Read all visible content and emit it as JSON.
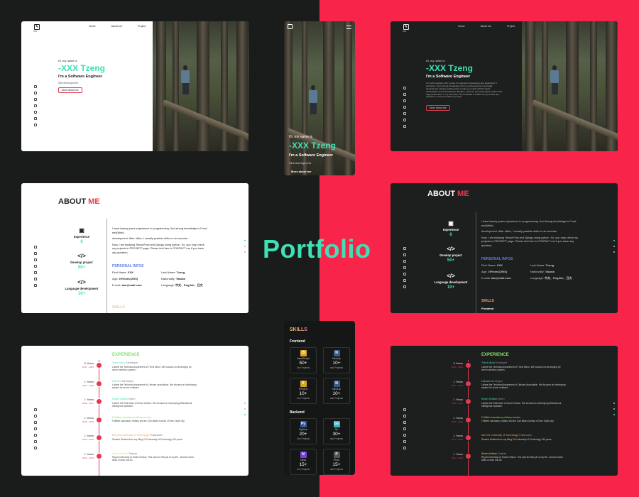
{
  "title": "Portfolio",
  "colors": {
    "left_bg": "#1a1b1b",
    "right_bg": "#f8244a",
    "accent_teal": "#3ee0b4",
    "accent_red": "#e8384f"
  },
  "nav": {
    "home": "Home",
    "about": "About me",
    "project": "Project"
  },
  "logo": {
    "glyph": "✎",
    "caption": "XXX"
  },
  "hero": {
    "greeting": "Hi, my name is",
    "name": "-XXX Tzeng",
    "role": "I'm a Software Engineer",
    "sub": "Self-development",
    "bio": "I'm much engineer with 3 years of experience developing web application in enterprise. Have strong knowledge of front-end development and agile development. Always seeking ways to stay up-to-date with the latest technologies and best practices. Besides, however, personal projects which have high performance in my own team. Don't hesitate to reach out if you have any questions or concerns about my work.",
    "button": "More about me"
  },
  "about": {
    "title_a": "ABOUT",
    "title_b": "ME",
    "stats": [
      {
        "icon": "briefcase-icon",
        "label": "Experience",
        "value": "6"
      },
      {
        "icon": "code-icon",
        "label": "Develop project",
        "value": "50+"
      },
      {
        "icon": "code-icon",
        "label": "Language development",
        "value": "10+"
      }
    ],
    "p1": "I have twenty years experience in programming. And strong knowledge in Front-end(Web).",
    "p2": "development. After office, I usually practise drills or do exercise.",
    "p3": "Now, I am studying TensorFlow and Django using python. So, you may check my projects in PROJECT page. Please feel free to CONTACT me if you have any question.",
    "personal_title": "PERSONAL INFOS",
    "info": {
      "first_name_label": "First Name:",
      "first_name": "XXX",
      "last_name_label": "Last Name:",
      "last_name": "Tzeng",
      "age_label": "Age:",
      "age": "29Years(1993)",
      "nationality_label": "Nationality:",
      "nationality": "Taiwan",
      "email_label": "E-mail:",
      "email": "ako@mail.com",
      "language_label": "Language:",
      "language": "中文、English、日文"
    },
    "skills_title": "SKILLS",
    "skills_sub": "Frontend"
  },
  "skills": {
    "title": "SKILLS",
    "frontend_label": "Frontend",
    "backend_label": "Backend",
    "frontend": [
      {
        "icon": "JS",
        "name": "JavaScript",
        "count": "50+",
        "label": "Live Projects",
        "color": "#e2a420"
      },
      {
        "icon": "N",
        "name": "Next.js",
        "count": "10+",
        "label": "asic Projects",
        "color": "#3b5d89"
      },
      {
        "icon": "5",
        "name": "HTML5",
        "count": "10+",
        "label": "Live Projects",
        "color": "#d9a424"
      },
      {
        "icon": "N",
        "name": "Next.js",
        "count": "10+",
        "label": "asic Projects",
        "color": "#3b5d89"
      }
    ],
    "backend": [
      {
        "icon": "Py",
        "name": "Python",
        "count": "20+",
        "label": "Live Projects",
        "color": "#2f5b9c"
      },
      {
        "icon": "Go",
        "name": "Go",
        "count": "30+",
        "label": "asic Projects",
        "color": "#3bb3c9"
      },
      {
        "icon": "N",
        "name": "Nest",
        "count": "15+",
        "label": "Live Projects",
        "color": "#7a3ee8"
      },
      {
        "icon": "P",
        "name": "Pixel",
        "count": "15+",
        "label": "asic Projects",
        "color": "#555"
      }
    ]
  },
  "experience": {
    "title": "EXPERIENCE",
    "items": [
      {
        "years": "6 Years",
        "range": "2017 - 2023",
        "title": "Trend Micro",
        "role": "Developer",
        "desc": "Lisbeel the Technical department of Trend Micro. We focused on developing for server antivirus system.",
        "color": "#3ee0b4"
      },
      {
        "years": "1 Years",
        "range": "2017 - 2018",
        "title": "Lifecare",
        "role": "Developer",
        "desc": "Lisbeel the Technical department of Lifecare Association. We focused on developing system for server software.",
        "color": "#3ee0b4"
      },
      {
        "years": "1 Years",
        "range": "2016 - 2017",
        "title": "Smart eVision",
        "role": "Intern",
        "desc": "Lisbeel the R&D team of Smart eVision. We focused on developing MiNotebook intelligence software.",
        "color": "#3ee0b4"
      },
      {
        "years": "1 Years",
        "range": "2015 - 2016",
        "title": "Fulfilled mandatory military service",
        "role": "",
        "desc": "Fulfilled mandatory military service Civil affairs bureau of New Taipei city.",
        "color": "#86e06b"
      },
      {
        "years": "1 Years",
        "range": "2013 - 2015",
        "title": "Min Chi University of Technology",
        "role": "Postmaster",
        "desc": "Student Studied from my Ming Chi University of Technology 2/N years.",
        "color": "#f2a25a"
      },
      {
        "years": "1 Years",
        "range": "2012 - 2013",
        "title": "Smart eVision",
        "role": "Trainee",
        "desc": "Report internship at Smart eVision. This was the first job of my life - learned some skills of work and lib.",
        "color": "#f5d451"
      }
    ]
  }
}
